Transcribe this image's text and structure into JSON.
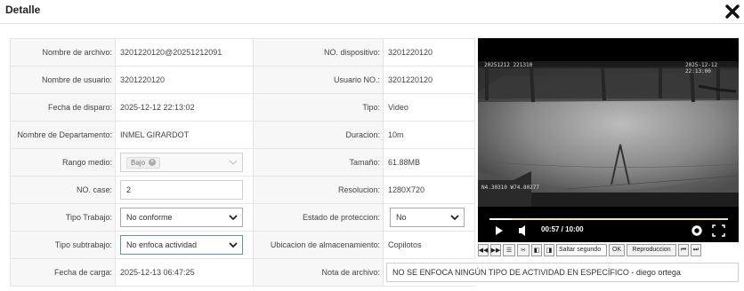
{
  "dialog": {
    "title": "Detalle"
  },
  "fields": {
    "nombre_archivo": {
      "label": "Nombre de archivo:",
      "value": "3201220120@20251212091"
    },
    "no_dispositivo": {
      "label": "NO. dispositivo:",
      "value": "3201220120"
    },
    "nombre_usuario": {
      "label": "Nombre de usuario:",
      "value": "3201220120"
    },
    "usuario_no": {
      "label": "Usuario NO.:",
      "value": "3201220120"
    },
    "fecha_disparo": {
      "label": "Fecha de disparo:",
      "value": "2025-12-12 22:13:02"
    },
    "tipo": {
      "label": "Tipo:",
      "value": "Video"
    },
    "departamento": {
      "label": "Nombre de Departamento:",
      "value": "INMEL GIRARDOT"
    },
    "duracion": {
      "label": "Duracion:",
      "value": "10m"
    },
    "rango_medio": {
      "label": "Rango medio:",
      "value": "Bajo"
    },
    "tamano": {
      "label": "Tamaño:",
      "value": "61.88MB"
    },
    "no_case": {
      "label": "NO. case:",
      "value": "2"
    },
    "resolucion": {
      "label": "Resolucion:",
      "value": "1280X720"
    },
    "tipo_trabajo": {
      "label": "Tipo Trabajo:",
      "value": "No conforme"
    },
    "estado_proteccion": {
      "label": "Estado de proteccion:",
      "value": "No"
    },
    "tipo_subtrabajo": {
      "label": "Tipo subtrabajo:",
      "value": "No enfoca actividad"
    },
    "ubicacion": {
      "label": "Ubicacion de almacenamiento:",
      "value": "Copilotos"
    },
    "fecha_carga": {
      "label": "Fecha de carga:",
      "value": "2025-12-13 06:47:25"
    },
    "nota_archivo": {
      "label": "Nota de archivo:",
      "value": "NO SE ENFOCA NINGÚN TIPO DE ACTIVIDAD EN ESPECÍFICO - diego ortega"
    }
  },
  "player": {
    "overlay_top_left": "20251212 221310",
    "overlay_top_right": "2025-12-12 22:13:00",
    "overlay_bottom_left": "N4.30310 W74.80277",
    "time": "00:57 / 10:00",
    "progress": 0.095
  },
  "toolbar": {
    "skip_placeholder": "Saltar segundo",
    "ok": "OK",
    "playback": "Reproduccion"
  }
}
